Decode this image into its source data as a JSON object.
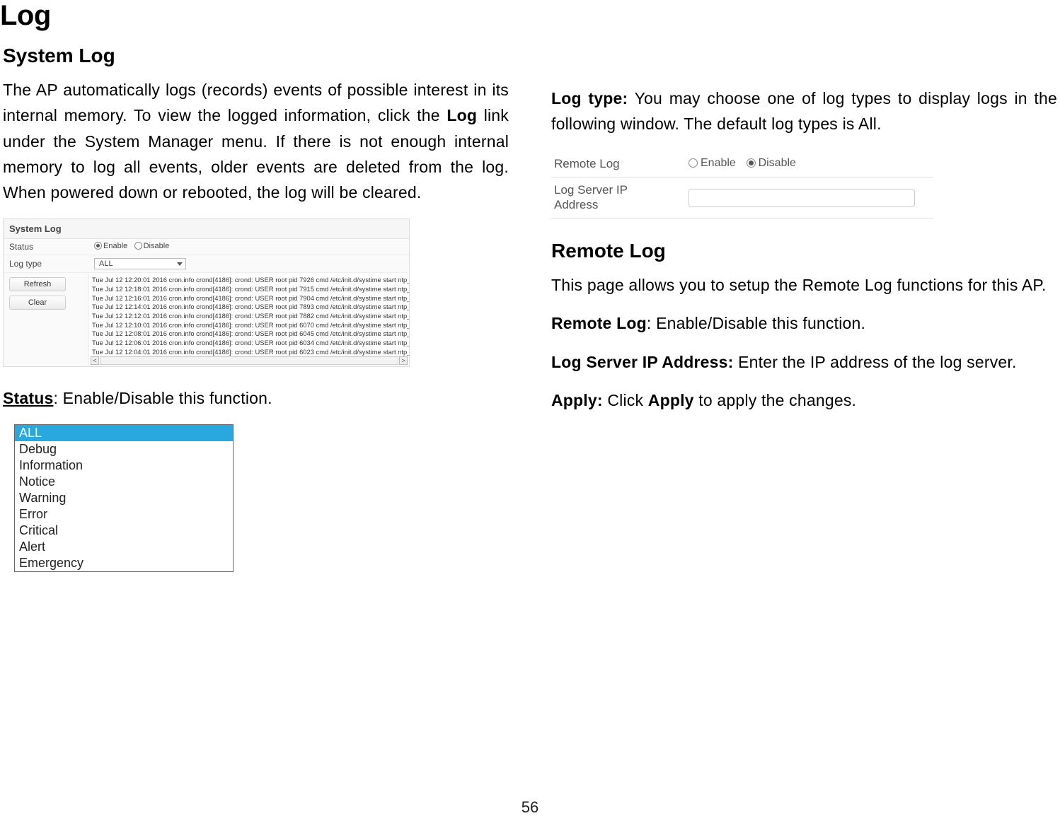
{
  "page": {
    "main_title": "Log",
    "page_number": "56"
  },
  "system_log": {
    "heading": "System Log",
    "intro_part1": "The AP automatically logs (records) events of possible interest in its internal memory. To view the logged information, click the ",
    "intro_bold": "Log",
    "intro_part2": " link under the System Manager menu. If there is not enough internal memory to log all events, older events are deleted from the log. When powered down or rebooted, the log will be cleared.",
    "screenshot": {
      "title": "System Log",
      "status_label": "Status",
      "enable": "Enable",
      "disable": "Disable",
      "logtype_label": "Log type",
      "logtype_value": "ALL",
      "refresh_btn": "Refresh",
      "clear_btn": "Clear",
      "loglines": [
        "Tue Jul 12 12:20:01 2016 cron.info crond[4186]: crond: USER root pid 7926 cmd /etc/init.d/systime start ntp_",
        "Tue Jul 12 12:18:01 2016 cron.info crond[4186]: crond: USER root pid 7915 cmd /etc/init.d/systime start ntp_",
        "Tue Jul 12 12:16:01 2016 cron.info crond[4186]: crond: USER root pid 7904 cmd /etc/init.d/systime start ntp_",
        "Tue Jul 12 12:14:01 2016 cron.info crond[4186]: crond: USER root pid 7893 cmd /etc/init.d/systime start ntp_",
        "Tue Jul 12 12:12:01 2016 cron.info crond[4186]: crond: USER root pid 7882 cmd /etc/init.d/systime start ntp_",
        "Tue Jul 12 12:10:01 2016 cron.info crond[4186]: crond: USER root pid 6070 cmd /etc/init.d/systime start ntp_",
        "Tue Jul 12 12:08:01 2016 cron.info crond[4186]: crond: USER root pid 6045 cmd /etc/init.d/systime start ntp_",
        "Tue Jul 12 12:06:01 2016 cron.info crond[4186]: crond: USER root pid 6034 cmd /etc/init.d/systime start ntp_",
        "Tue Jul 12 12:04:01 2016 cron.info crond[4186]: crond: USER root pid 6023 cmd /etc/init.d/systime start ntp_"
      ]
    },
    "status_bold": "Status",
    "status_text": ": Enable/Disable this function.",
    "dropdown_items": [
      "ALL",
      "Debug",
      "Information",
      "Notice",
      "Warning",
      "Error",
      "Critical",
      "Alert",
      "Emergency"
    ]
  },
  "log_type": {
    "label_bold": "Log type:",
    "label_text": " You may choose one of log types to display logs in the following window. The default log types is All."
  },
  "remote_log_screenshot": {
    "label1": "Remote Log",
    "enable": "Enable",
    "disable": "Disable",
    "label2_line1": "Log Server IP",
    "label2_line2": "Address"
  },
  "remote_log": {
    "heading": "Remote Log",
    "intro": "This page allows you to setup the Remote Log functions for this AP.",
    "row1_bold": "Remote Log",
    "row1_text": ": Enable/Disable this function.",
    "row2_bold": "Log Server IP Address:",
    "row2_text": " Enter the IP address of the log server.",
    "row3_bold": "Apply:",
    "row3_text1": " Click ",
    "row3_bold2": "Apply",
    "row3_text2": " to apply the changes."
  }
}
